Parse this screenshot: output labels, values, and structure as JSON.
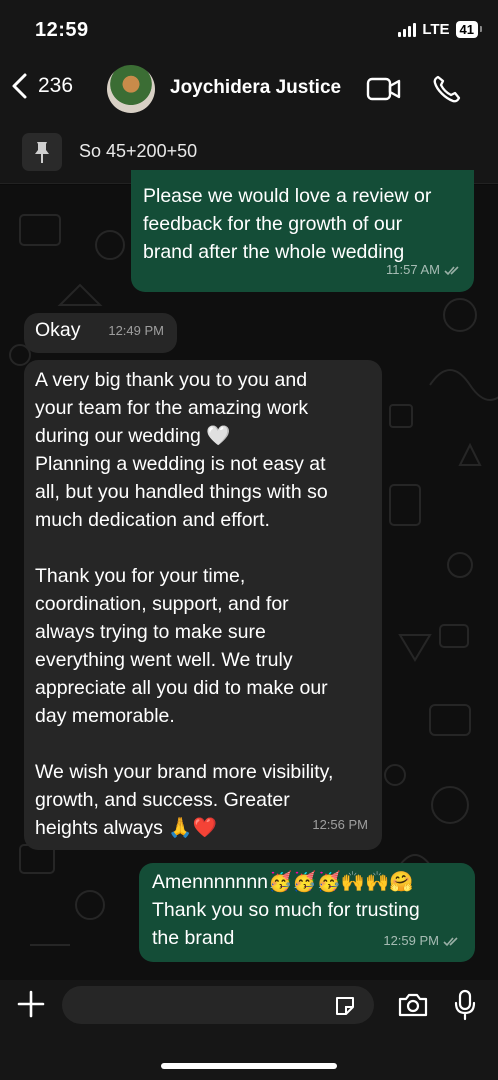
{
  "status_bar": {
    "time": "12:59",
    "network": "LTE",
    "battery": "41"
  },
  "header": {
    "back_count": "236",
    "contact_name": "Joychidera Justice"
  },
  "pinned": {
    "text": "So 45+200+50"
  },
  "messages": [
    {
      "direction": "outgoing",
      "text": "Please we would love a review or\nfeedback for the growth of our\nbrand after the whole wedding",
      "time": "11:57 AM",
      "status": "read"
    },
    {
      "direction": "incoming",
      "text": "Okay",
      "time": "12:49 PM"
    },
    {
      "direction": "incoming",
      "text": "A very big thank you to you and\nyour team for the amazing work\nduring our wedding 🤍\nPlanning a wedding is not easy at\nall, but you handled things with so\nmuch dedication and effort.\n\nThank you for your time,\ncoordination, support, and for\nalways trying to make sure\neverything went well. We truly\nappreciate all you did to make our\nday memorable.\n\nWe wish your brand more visibility,\ngrowth, and success. Greater\nheights always 🙏❤️",
      "time": "12:56 PM"
    },
    {
      "direction": "outgoing",
      "text": "Amennnnnnn🥳🥳🥳🙌🙌🤗\nThank you so much for trusting\nthe brand",
      "time": "12:59 PM",
      "status": "read"
    }
  ],
  "input": {
    "placeholder": ""
  },
  "colors": {
    "outgoing_bubble": "#144d37",
    "incoming_bubble": "#262626",
    "background": "#0f0f0f",
    "read_ticks": "#9ab0a6"
  }
}
